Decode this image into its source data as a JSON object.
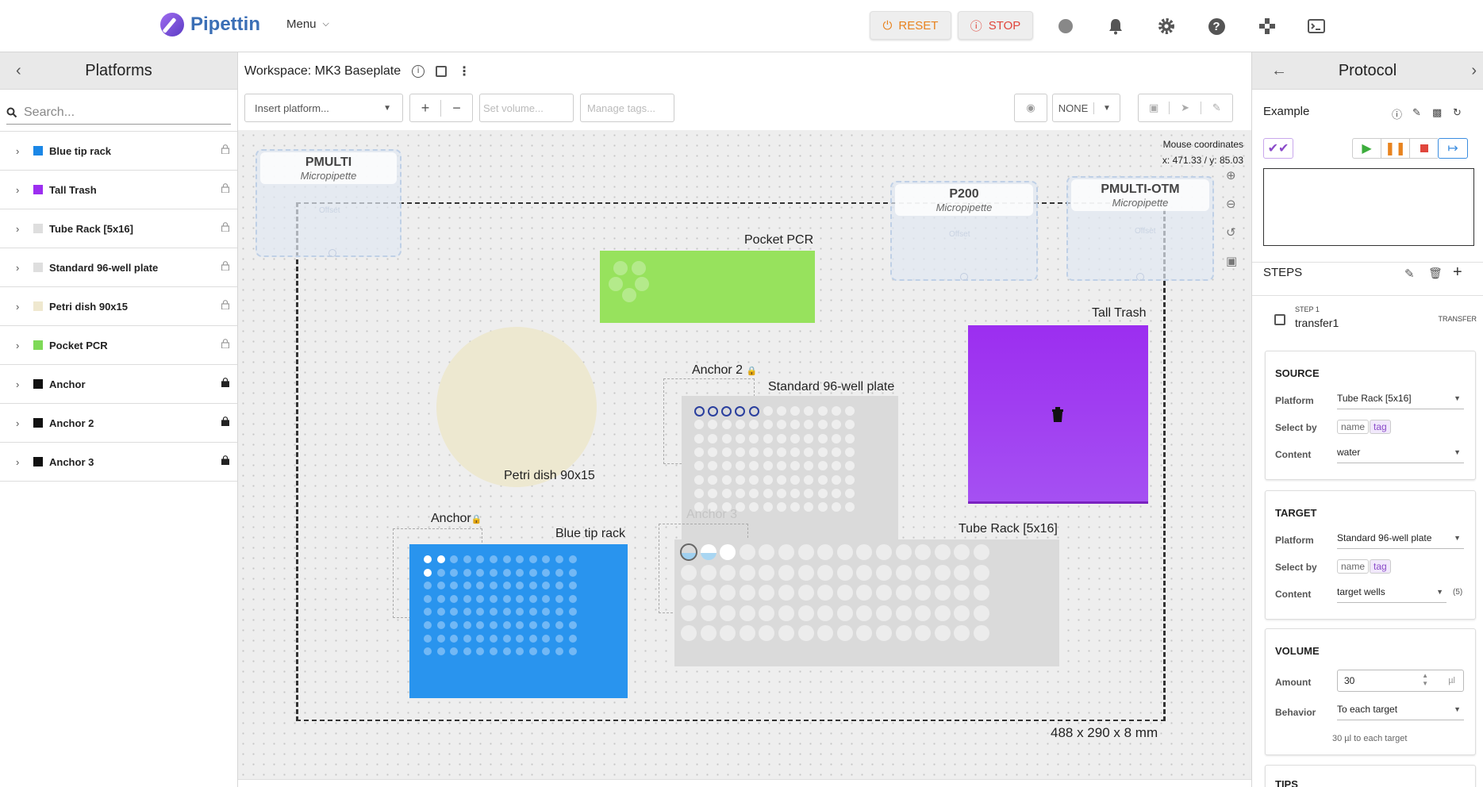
{
  "app": {
    "name": "Pipettin",
    "menu_label": "Menu",
    "reset_label": "RESET",
    "stop_label": "STOP"
  },
  "colors": {
    "accent": "#3b6fb6",
    "reset": "#e8831f",
    "stop": "#e0463c",
    "purple": "#9c2ef0",
    "blue": "#2994ee",
    "green": "#97e25d"
  },
  "left_panel": {
    "title": "Platforms",
    "search_placeholder": "Search...",
    "items": [
      {
        "label": "Blue tip rack",
        "color": "#1b87e6",
        "locked": false
      },
      {
        "label": "Tall Trash",
        "color": "#9c2ef0",
        "locked": false
      },
      {
        "label": "Tube Rack [5x16]",
        "color": "#dedede",
        "locked": false
      },
      {
        "label": "Standard 96-well plate",
        "color": "#dedede",
        "locked": false
      },
      {
        "label": "Petri dish 90x15",
        "color": "#efe8cf",
        "locked": false
      },
      {
        "label": "Pocket PCR",
        "color": "#7ed957",
        "locked": false
      },
      {
        "label": "Anchor",
        "color": "#111111",
        "locked": true
      },
      {
        "label": "Anchor 2",
        "color": "#111111",
        "locked": true
      },
      {
        "label": "Anchor 3",
        "color": "#111111",
        "locked": true
      }
    ]
  },
  "workspace": {
    "title": "Workspace: MK3 Baseplate",
    "insert_placeholder": "Insert platform...",
    "volume_placeholder": "Set volume...",
    "tags_placeholder": "Manage tags...",
    "view_mode": "NONE",
    "mouse_label": "Mouse coordinates",
    "mouse_xy": "x: 471.33 / y: 85.03",
    "dims": "488 x 290 x 8 mm",
    "heads": [
      {
        "name": "PMULTI",
        "type": "Micropipette"
      },
      {
        "name": "P200",
        "type": "Micropipette"
      },
      {
        "name": "PMULTI-OTM",
        "type": "Micropipette"
      }
    ],
    "offset_label": "Offset",
    "labels": {
      "pocket_pcr": "Pocket PCR",
      "tall_trash": "Tall Trash",
      "anchor2": "Anchor 2",
      "plate96": "Standard 96-well plate",
      "petri": "Petri dish 90x15",
      "anchor": "Anchor",
      "tiprack": "Blue tip rack",
      "anchor3": "Anchor 3",
      "tuberack": "Tube Rack [5x16]"
    }
  },
  "protocol": {
    "title": "Protocol",
    "name": "Example",
    "steps_label": "STEPS",
    "step": {
      "number": "STEP 1",
      "name": "transfer1",
      "type": "TRANSFER"
    },
    "source": {
      "title": "SOURCE",
      "platform_label": "Platform",
      "platform": "Tube Rack [5x16]",
      "select_label": "Select by",
      "chip_name": "name",
      "chip_tag": "tag",
      "content_label": "Content",
      "content": "water"
    },
    "target": {
      "title": "TARGET",
      "platform_label": "Platform",
      "platform": "Standard 96-well plate",
      "select_label": "Select by",
      "chip_name": "name",
      "chip_tag": "tag",
      "content_label": "Content",
      "content": "target wells",
      "count": "(5)"
    },
    "volume": {
      "title": "VOLUME",
      "amount_label": "Amount",
      "amount": "30",
      "unit": "µl",
      "behavior_label": "Behavior",
      "behavior": "To each target",
      "hint": "30 µl to each target"
    },
    "tips_title": "TIPS"
  }
}
